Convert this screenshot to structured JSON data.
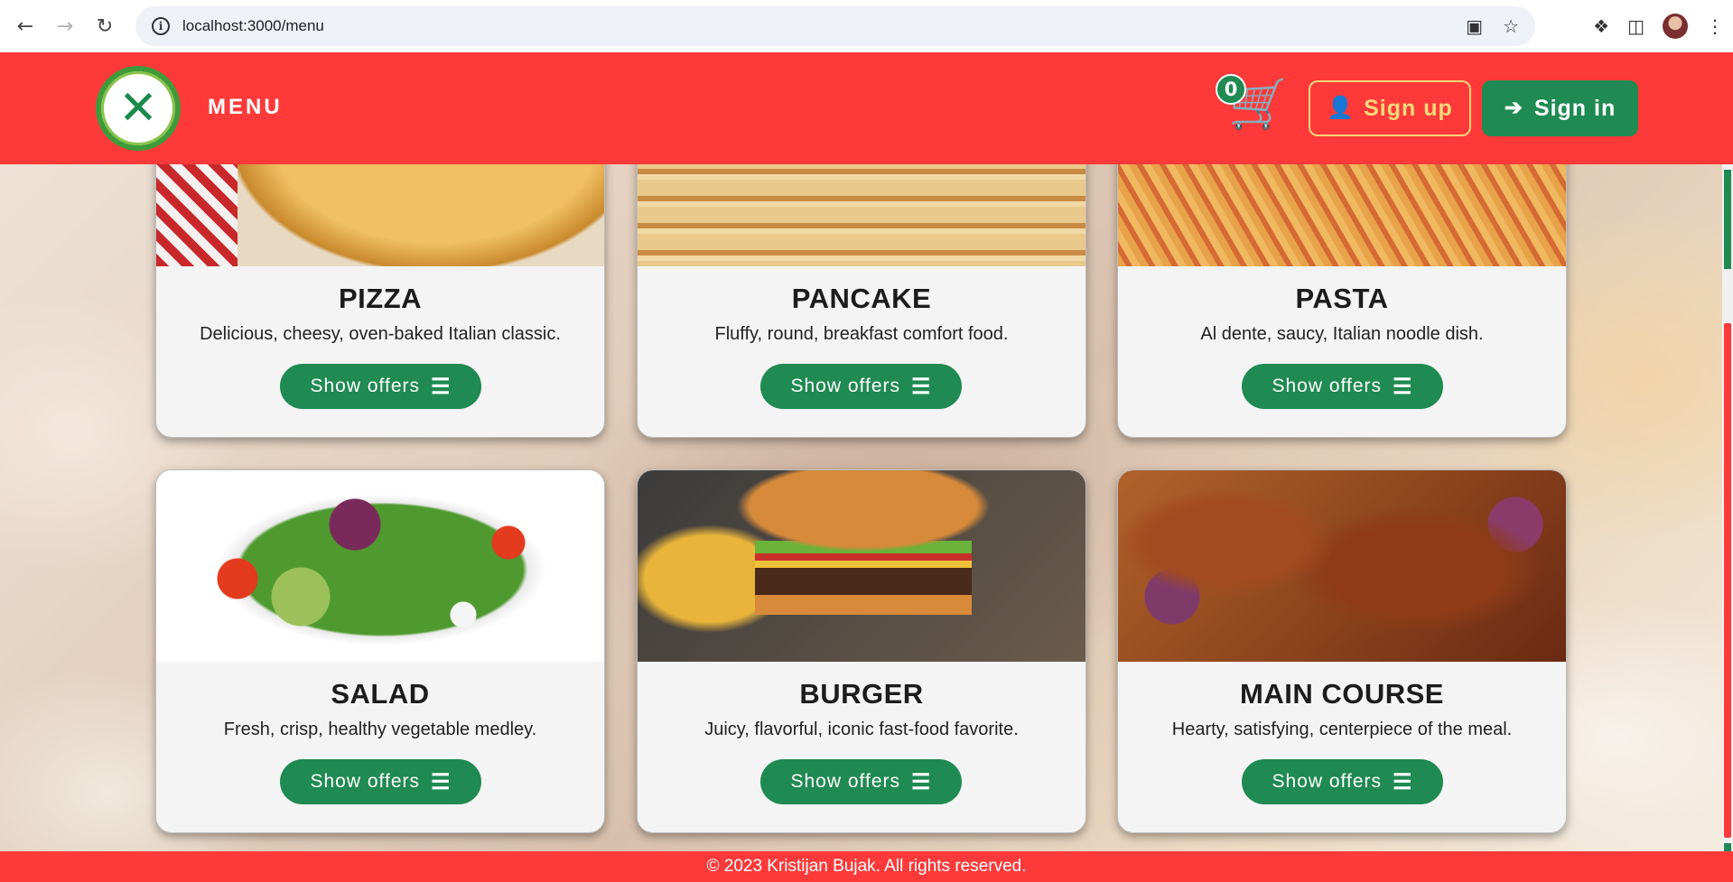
{
  "browser": {
    "url": "localhost:3000/menu",
    "info_icon": "i"
  },
  "header": {
    "nav_label": "MENU",
    "cart_count": "0",
    "signup_label": "Sign up",
    "signin_label": "Sign in"
  },
  "cards": [
    {
      "title": "PIZZA",
      "description": "Delicious, cheesy, oven-baked Italian classic.",
      "button": "Show offers",
      "image": "pizza"
    },
    {
      "title": "PANCAKE",
      "description": "Fluffy, round, breakfast comfort food.",
      "button": "Show offers",
      "image": "pancake"
    },
    {
      "title": "PASTA",
      "description": "Al dente, saucy, Italian noodle dish.",
      "button": "Show offers",
      "image": "pasta"
    },
    {
      "title": "SALAD",
      "description": "Fresh, crisp, healthy vegetable medley.",
      "button": "Show offers",
      "image": "salad"
    },
    {
      "title": "BURGER",
      "description": "Juicy, flavorful, iconic fast-food favorite.",
      "button": "Show offers",
      "image": "burger"
    },
    {
      "title": "MAIN COURSE",
      "description": "Hearty, satisfying, centerpiece of the meal.",
      "button": "Show offers",
      "image": "main-course"
    }
  ],
  "footer": {
    "text": "© 2023 Kristijan Bujak. All rights reserved."
  },
  "colors": {
    "header_red": "#fd3a39",
    "brand_green": "#1f8a52",
    "signup_gold": "#f7d97c"
  },
  "icons": [
    "back-icon",
    "forward-icon",
    "reload-icon",
    "site-info-icon",
    "install-icon",
    "bookmark-star-icon",
    "extensions-icon",
    "sidebar-icon",
    "profile-avatar",
    "more-icon",
    "logo-fork-knife-icon",
    "cart-icon",
    "user-icon",
    "sign-in-icon",
    "list-icon"
  ]
}
